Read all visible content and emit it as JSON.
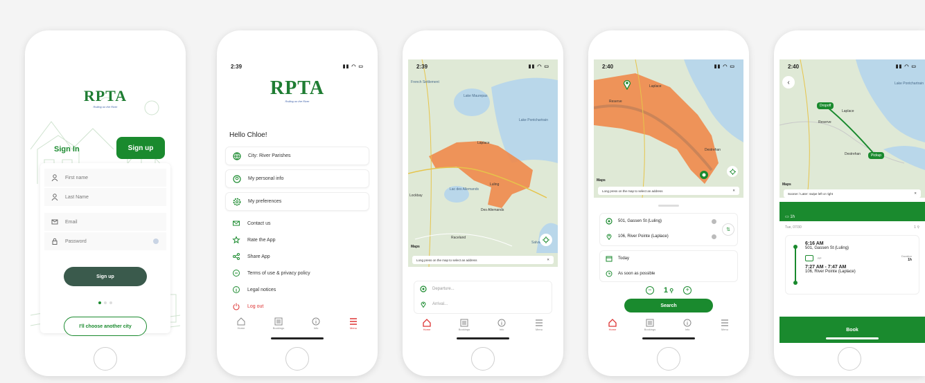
{
  "colors": {
    "brand_green": "#1a8a2e",
    "service_area": "#f08a4b",
    "water": "#b9d7ea",
    "menu_active": "#d33333"
  },
  "logo": {
    "text": "RPTA",
    "tagline": "Rolling on the River"
  },
  "phone1": {
    "tab_signin": "Sign In",
    "tab_signup": "Sign up",
    "fields": {
      "first_name": "First name",
      "last_name": "Last Name",
      "email": "Email",
      "password": "Password"
    },
    "signup_button": "Sign up",
    "choose_city": "I'll choose another city"
  },
  "phone2": {
    "time": "2:39",
    "greeting": "Hello Chloe!",
    "cards": [
      "City: River Parishes",
      "My personal info",
      "My preferences"
    ],
    "items": [
      "Contact us",
      "Rate the App",
      "Share App",
      "Terms of use & privacy policy",
      "Legal notices",
      "Log out"
    ],
    "tabs": [
      "Home",
      "Bookings",
      "Info",
      "Menu"
    ]
  },
  "phone3": {
    "time": "2:39",
    "labels": [
      "Lake Maurepas",
      "Lake Pontchartrain",
      "Laplace",
      "Luling",
      "Lac des Allemands",
      "Des Allemands",
      "Raceland",
      "Salvador",
      "Lockbay",
      "French Settlement"
    ],
    "maps_credit": "Maps",
    "note": "Long press on the map to select an address",
    "departure": "Departure...",
    "arrival": "Arrival...",
    "tabs": [
      "Home",
      "Bookings",
      "Info",
      "Menu"
    ]
  },
  "phone4": {
    "time": "2:40",
    "labels": [
      "Laplace",
      "Reserve",
      "Destrehan"
    ],
    "maps_credit": "Maps",
    "note": "Long press on the map to select an address",
    "from": "501, Gassen St (Luling)",
    "to": "106, River Pointe (Laplace)",
    "date": "Today",
    "when": "As soon as possible",
    "passengers": "1",
    "search": "Search",
    "tabs": [
      "Home",
      "Bookings",
      "Info",
      "Menu"
    ]
  },
  "phone5": {
    "time": "2:40",
    "labels": [
      "Laplace",
      "Reserve",
      "Destrehan",
      "Lake Pontchartrain"
    ],
    "pin_dropoff": "Dropoff",
    "pin_pickup": "Pickup",
    "maps_credit": "Maps",
    "note": "Sooner / Later: swipe left or right",
    "duration_header": "1h",
    "date": "Tue, 07/30",
    "passengers": "1",
    "pickup_time": "6:16 AM",
    "pickup_addr": "501, Gassen St (Luling)",
    "vehicle": "RP",
    "duration_label": "Duration",
    "duration_value": "1h",
    "dropoff_time": "7:27 AM - 7:47 AM",
    "dropoff_addr": "106, River Pointe (Laplace)",
    "book": "Book"
  }
}
